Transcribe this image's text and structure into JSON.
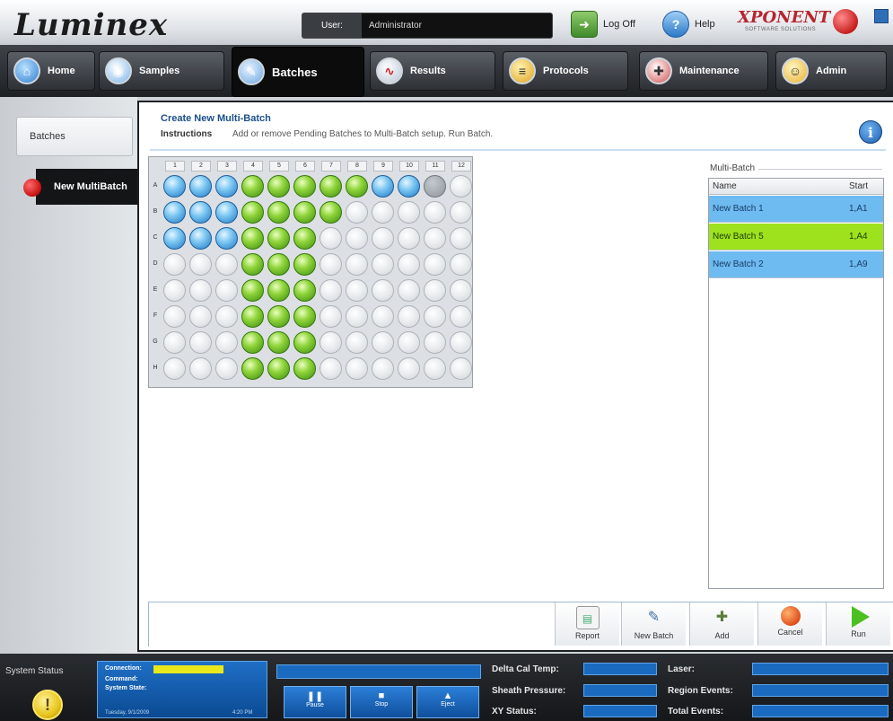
{
  "header": {
    "logo": "Luminex",
    "user_label": "User:",
    "user_value": "Administrator",
    "logoff_label": "Log Off",
    "help_label": "Help",
    "product_logo": "XPONENT",
    "product_sub": "SOFTWARE SOLUTIONS"
  },
  "nav": {
    "tabs": [
      {
        "label": "Home",
        "icon": "home-icon"
      },
      {
        "label": "Samples",
        "icon": "samples-icon"
      },
      {
        "label": "Batches",
        "icon": "batches-icon",
        "active": true
      },
      {
        "label": "Results",
        "icon": "results-icon"
      },
      {
        "label": "Protocols",
        "icon": "protocols-icon"
      },
      {
        "label": "Maintenance",
        "icon": "maintenance-icon"
      },
      {
        "label": "Admin",
        "icon": "admin-icon"
      }
    ]
  },
  "sidebar": {
    "items": [
      {
        "label": "Batches"
      },
      {
        "label": "New MultiBatch",
        "active": true
      }
    ]
  },
  "main": {
    "title": "Create New Multi-Batch",
    "instructions_label": "Instructions",
    "instructions_text": "Add or remove Pending Batches to Multi-Batch setup. Run Batch.",
    "info_label": "i"
  },
  "plate": {
    "columns": [
      "1",
      "2",
      "3",
      "4",
      "5",
      "6",
      "7",
      "8",
      "9",
      "10",
      "11",
      "12"
    ],
    "rows": [
      "A",
      "B",
      "C",
      "D",
      "E",
      "F",
      "G",
      "H"
    ],
    "wells": [
      [
        "blue",
        "blue",
        "blue",
        "green",
        "green",
        "green",
        "green",
        "green",
        "blue",
        "blue",
        "gray",
        "empty"
      ],
      [
        "blue",
        "blue",
        "blue",
        "green",
        "green",
        "green",
        "green",
        "empty",
        "empty",
        "empty",
        "empty",
        "empty"
      ],
      [
        "blue",
        "blue",
        "blue",
        "green",
        "green",
        "green",
        "empty",
        "empty",
        "empty",
        "empty",
        "empty",
        "empty"
      ],
      [
        "empty",
        "empty",
        "empty",
        "green",
        "green",
        "green",
        "empty",
        "empty",
        "empty",
        "empty",
        "empty",
        "empty"
      ],
      [
        "empty",
        "empty",
        "empty",
        "green",
        "green",
        "green",
        "empty",
        "empty",
        "empty",
        "empty",
        "empty",
        "empty"
      ],
      [
        "empty",
        "empty",
        "empty",
        "green",
        "green",
        "green",
        "empty",
        "empty",
        "empty",
        "empty",
        "empty",
        "empty"
      ],
      [
        "empty",
        "empty",
        "empty",
        "green",
        "green",
        "green",
        "empty",
        "empty",
        "empty",
        "empty",
        "empty",
        "empty"
      ],
      [
        "empty",
        "empty",
        "empty",
        "green",
        "green",
        "green",
        "empty",
        "empty",
        "empty",
        "empty",
        "empty",
        "empty"
      ]
    ]
  },
  "multibatch": {
    "label": "Multi-Batch",
    "col_name": "Name",
    "col_start": "Start",
    "rows": [
      {
        "name": "New Batch 1",
        "start": "1,A1",
        "color": "blue"
      },
      {
        "name": "New Batch 5",
        "start": "1,A4",
        "color": "green"
      },
      {
        "name": "New Batch 2",
        "start": "1,A9",
        "color": "blue"
      }
    ]
  },
  "toolbar": {
    "report": "Report",
    "new_batch": "New Batch",
    "add": "Add",
    "cancel": "Cancel",
    "run": "Run"
  },
  "status": {
    "system_status": "System Status",
    "connection": "Connection:",
    "command": "Command:",
    "system_state": "System State:",
    "date": "Tuesday, 9/1/2009",
    "time": "4:20 PM",
    "pause": "Pause",
    "stop": "Stop",
    "eject": "Eject",
    "delta_cal_temp": "Delta Cal Temp:",
    "sheath_pressure": "Sheath Pressure:",
    "xy_status": "XY Status:",
    "laser": "Laser:",
    "region_events": "Region Events:",
    "total_events": "Total Events:"
  },
  "colors": {
    "accent_blue": "#1b4f8a",
    "well_blue": "#7cc7f2",
    "well_green": "#8fd43a",
    "row_blue": "#6dbbf0",
    "row_green": "#9de21c",
    "status_blue": "#1a6bc0"
  }
}
